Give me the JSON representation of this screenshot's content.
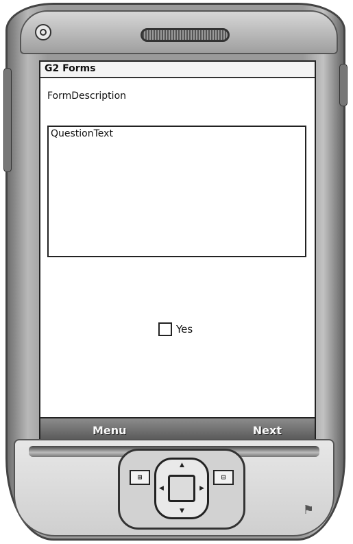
{
  "screen": {
    "app_title": "G2 Forms",
    "form_description": "FormDescription",
    "question_text": "QuestionText",
    "yes_option": {
      "label": "Yes",
      "checked": false
    }
  },
  "softkeys": {
    "left": "Menu",
    "right": "Next"
  },
  "hardware_keys": {
    "left_icon": "start-menu-icon",
    "right_icon": "ok-key-icon",
    "nav_icon": "dpad-icon",
    "brand_icon": "windows-flag-icon"
  }
}
